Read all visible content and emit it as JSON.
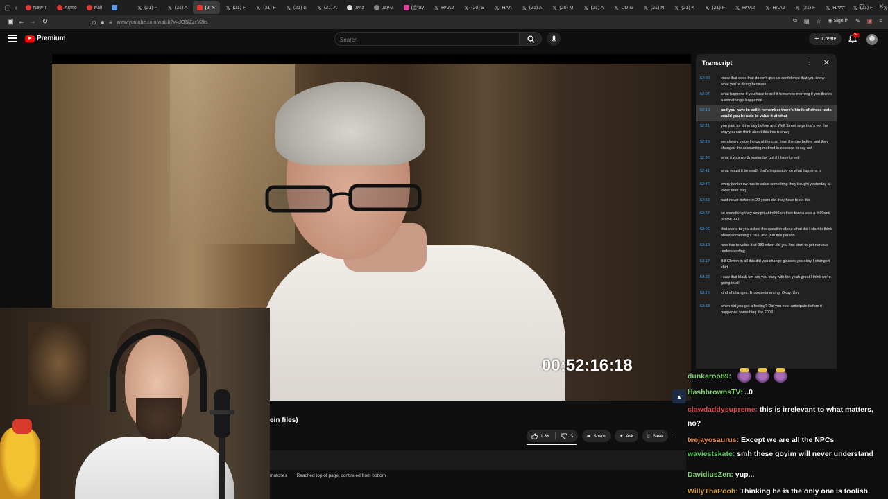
{
  "browser": {
    "tabs": [
      {
        "label": "New T",
        "icon": "red-circle",
        "active": false
      },
      {
        "label": "Asmo",
        "icon": "red-circle",
        "active": false
      },
      {
        "label": "r/all",
        "icon": "red-circle",
        "active": false
      },
      {
        "label": "",
        "icon": "blue-square",
        "active": false
      },
      {
        "label": "(21) F",
        "icon": "x",
        "active": false
      },
      {
        "label": "(21) A",
        "icon": "x",
        "active": false
      },
      {
        "label": "(2",
        "icon": "youtube",
        "active": true
      },
      {
        "label": "(21) F",
        "icon": "x",
        "active": false
      },
      {
        "label": "(21) F",
        "icon": "x",
        "active": false
      },
      {
        "label": "(21) S",
        "icon": "x",
        "active": false
      },
      {
        "label": "(21) A",
        "icon": "x",
        "active": false
      },
      {
        "label": "jay z",
        "icon": "white-circle",
        "active": false
      },
      {
        "label": "Jay-Z",
        "icon": "misc",
        "active": false
      },
      {
        "label": "(@jay",
        "icon": "pink-square",
        "active": false
      },
      {
        "label": "HAA2",
        "icon": "x",
        "active": false
      },
      {
        "label": "(20) S",
        "icon": "x",
        "active": false
      },
      {
        "label": "HAA",
        "icon": "x",
        "active": false
      },
      {
        "label": "(21) A",
        "icon": "x",
        "active": false
      },
      {
        "label": "(20) M",
        "icon": "x",
        "active": false
      },
      {
        "label": "(21) A",
        "icon": "x",
        "active": false
      },
      {
        "label": "DD G",
        "icon": "x",
        "active": false
      },
      {
        "label": "(21) N",
        "icon": "x",
        "active": false
      },
      {
        "label": "(21) K",
        "icon": "x",
        "active": false
      },
      {
        "label": "(21) F",
        "icon": "x",
        "active": false
      },
      {
        "label": "HAA2",
        "icon": "x",
        "active": false
      },
      {
        "label": "HAA2",
        "icon": "x",
        "active": false
      },
      {
        "label": "(21) F",
        "icon": "x",
        "active": false
      },
      {
        "label": "HAA",
        "icon": "x",
        "active": false
      },
      {
        "label": "(21) F",
        "icon": "x",
        "active": false
      },
      {
        "label": "(21) A",
        "icon": "x",
        "active": false
      },
      {
        "label": "A",
        "icon": "x",
        "active": false
      }
    ],
    "new_tab": "+",
    "url": "www.youtube.com/watch?v=dOSlZzcV2ks",
    "sign_in": "Sign in"
  },
  "youtube": {
    "logo_text": "Premium",
    "search_placeholder": "Search",
    "create_label": "Create",
    "notification_badge": "9+"
  },
  "video": {
    "overlay_timestamp": "00:52:16:18",
    "title_fragment": "ein files)",
    "likes": "1.3K",
    "dislikes": "3",
    "share": "Share",
    "ask": "Ask",
    "save": "Save",
    "more": "..."
  },
  "find_bar": {
    "matches": "matches",
    "status": "Reached top of page, continued from bottom"
  },
  "transcript": {
    "title": "Transcript",
    "segments": [
      {
        "time": "52:00",
        "text": "know that does that doesn't give us confidence that you know what you're doing because",
        "active": false
      },
      {
        "time": "52:07",
        "text": "what happens if you have to sell it tomorrow morning if you there's a something's happened",
        "active": false
      },
      {
        "time": "52:13",
        "text": "and you have to sell it remember there's kinds of stress tests would you be able to value it at what",
        "active": true
      },
      {
        "time": "52:21",
        "text": "you paid for it the day before and Wall Street says that's not the way you can think about this this is crazy",
        "active": false
      },
      {
        "time": "52:28",
        "text": "we always value things at the cost from the day before and they changed the accounting method in essence to say not",
        "active": false
      },
      {
        "time": "52:36",
        "text": "what it was worth yesterday but if I have to sell",
        "active": false
      },
      {
        "time": "52:41",
        "text": "what would it be worth that's impossible so what happens is",
        "active": false
      },
      {
        "time": "52:46",
        "text": "every bank now has to value something they bought yesterday at lower than they",
        "active": false
      },
      {
        "time": "52:52",
        "text": "paid never before in 20 years did they have to do this",
        "active": false
      },
      {
        "time": "52:57",
        "text": "so something they bought at th000 on their books was a th00and is now 990",
        "active": false
      },
      {
        "time": "53:06",
        "text": "that starts to you asked the question about what did I start to think about something's ,000 and 990 this person",
        "active": false
      },
      {
        "time": "53:13",
        "text": "now has to value it at 980 when did you first start to get nervous understanding",
        "active": false
      },
      {
        "time": "53:17",
        "text": "Bill Clinton in all this did you change glasses yes okay I changed shirt",
        "active": false
      },
      {
        "time": "53:23",
        "text": "I saw that black um are you okay with the yeah great I think we're going to all",
        "active": false
      },
      {
        "time": "53:28",
        "text": "kind of changes. I'm experimenting. Okay. Um,",
        "active": false
      },
      {
        "time": "53:33",
        "text": "when did you get a feeling? Did you ever anticipate before it happened something like 2008",
        "active": false
      }
    ]
  },
  "chat": {
    "messages": [
      {
        "user": "dunkaroo89:",
        "text": "",
        "color": "#7fd46a",
        "emotes": 3
      },
      {
        "user": "HashbrownsTV:",
        "text": "..0",
        "color": "#7fd46a",
        "emotes": 0
      },
      {
        "user": "clawdaddysupreme:",
        "text": "this is irrelevant to what matters,",
        "color": "#e0484a",
        "emotes": 0
      },
      {
        "user": "",
        "text": "no?",
        "color": "#ffffff",
        "emotes": 0
      },
      {
        "user": "teejayosaurus:",
        "text": "Except we are all the NPCs",
        "color": "#e58a43",
        "emotes": 0
      },
      {
        "user": "waviestskate:",
        "text": "smh these goyim will never understand",
        "color": "#57d15a",
        "emotes": 0
      },
      {
        "user": "DavidiusZen:",
        "text": "yup...",
        "color": "#7fd46a",
        "emotes": 0
      },
      {
        "user": "WillyThaPooh:",
        "text": "Thinking he is the only one is foolish.",
        "color": "#d9a23c",
        "emotes": 0
      }
    ]
  }
}
